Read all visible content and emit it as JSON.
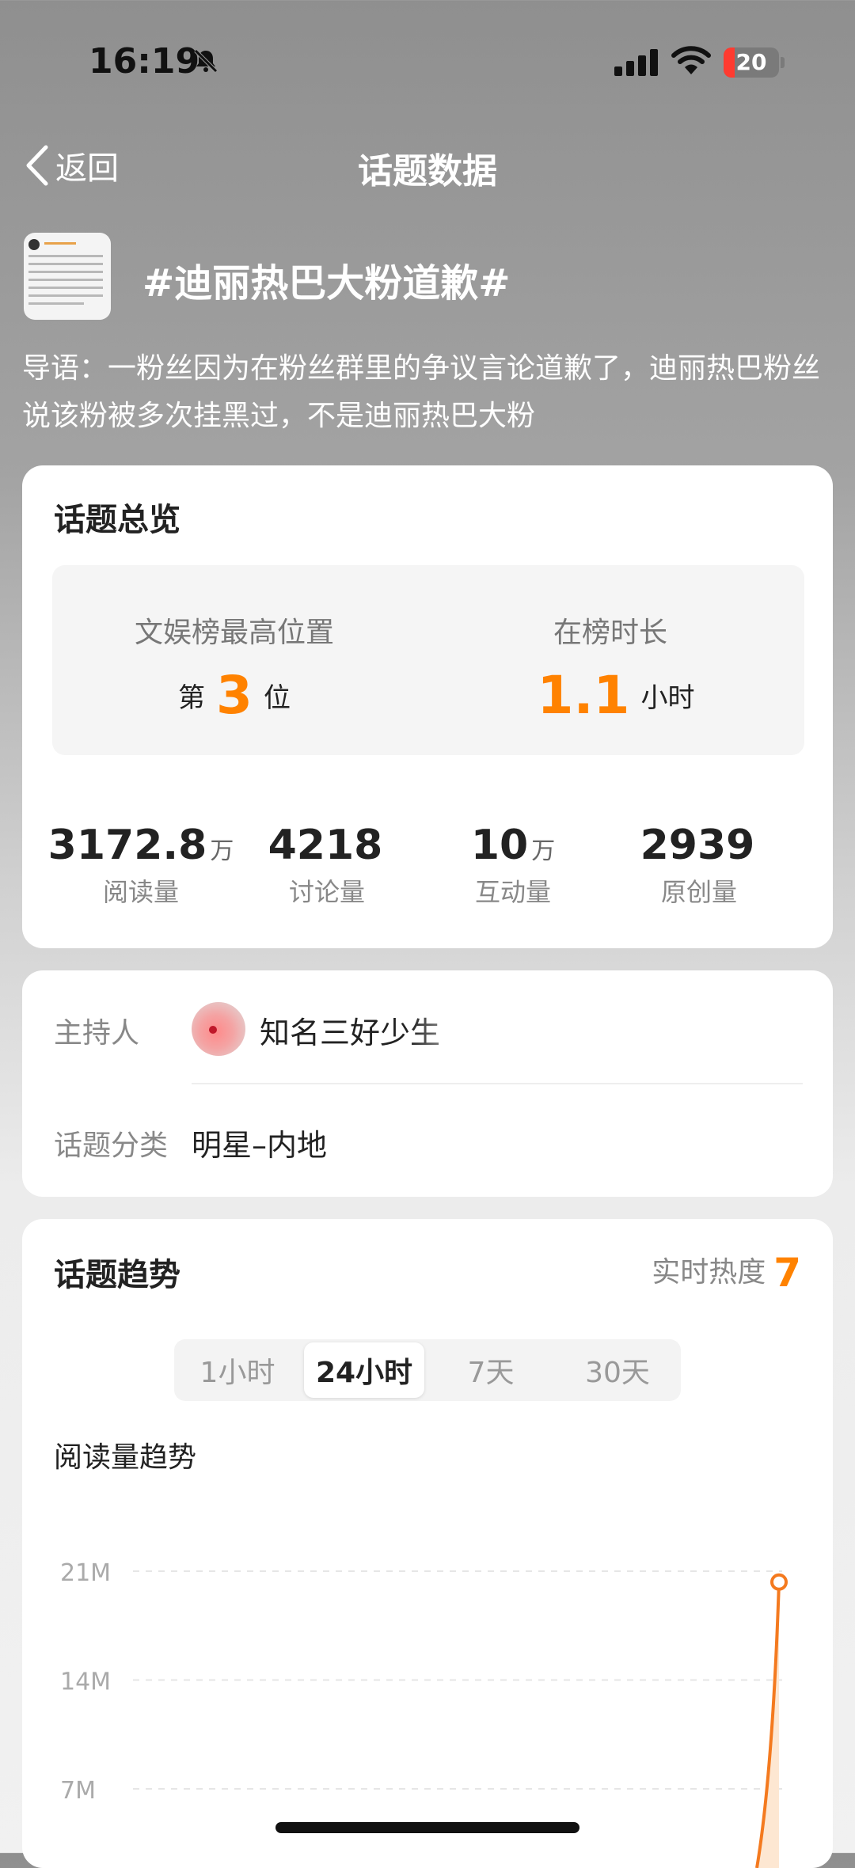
{
  "status_bar": {
    "time": "16:19",
    "battery": "20"
  },
  "nav": {
    "back_label": "返回",
    "title": "话题数据"
  },
  "topic": {
    "title": "#迪丽热巴大粉道歉#",
    "lead": "导语：一粉丝因为在粉丝群里的争议言论道歉了，迪丽热巴粉丝说该粉被多次挂黑过，不是迪丽热巴大粉"
  },
  "overview": {
    "title": "话题总览",
    "rank_label": "文娱榜最高位置",
    "rank_prefix": "第",
    "rank_value": "3",
    "rank_suffix": "位",
    "duration_label": "在榜时长",
    "duration_value": "1.1",
    "duration_unit": "小时",
    "stats": [
      {
        "num": "3172.8",
        "unit": "万",
        "label": "阅读量"
      },
      {
        "num": "4218",
        "unit": "",
        "label": "讨论量"
      },
      {
        "num": "10",
        "unit": "万",
        "label": "互动量"
      },
      {
        "num": "2939",
        "unit": "",
        "label": "原创量"
      }
    ]
  },
  "info": {
    "host_label": "主持人",
    "host_name": "知名三好少生",
    "category_label": "话题分类",
    "category_value": "明星–内地"
  },
  "trend": {
    "title": "话题趋势",
    "heat_label": "实时热度",
    "heat_value": "7",
    "tabs": [
      "1小时",
      "24小时",
      "7天",
      "30天"
    ],
    "active_tab": 1,
    "chart_title": "阅读量趋势"
  },
  "colors": {
    "accent": "#ff8200",
    "line": "#f47a1f"
  },
  "chart_data": {
    "type": "line",
    "title": "阅读量趋势",
    "y_ticks": [
      "21M",
      "14M",
      "7M"
    ],
    "ylim": [
      0,
      21
    ],
    "y_unit": "M",
    "series": [
      {
        "values": [
          0,
          20.3
        ]
      }
    ],
    "grid": true
  }
}
